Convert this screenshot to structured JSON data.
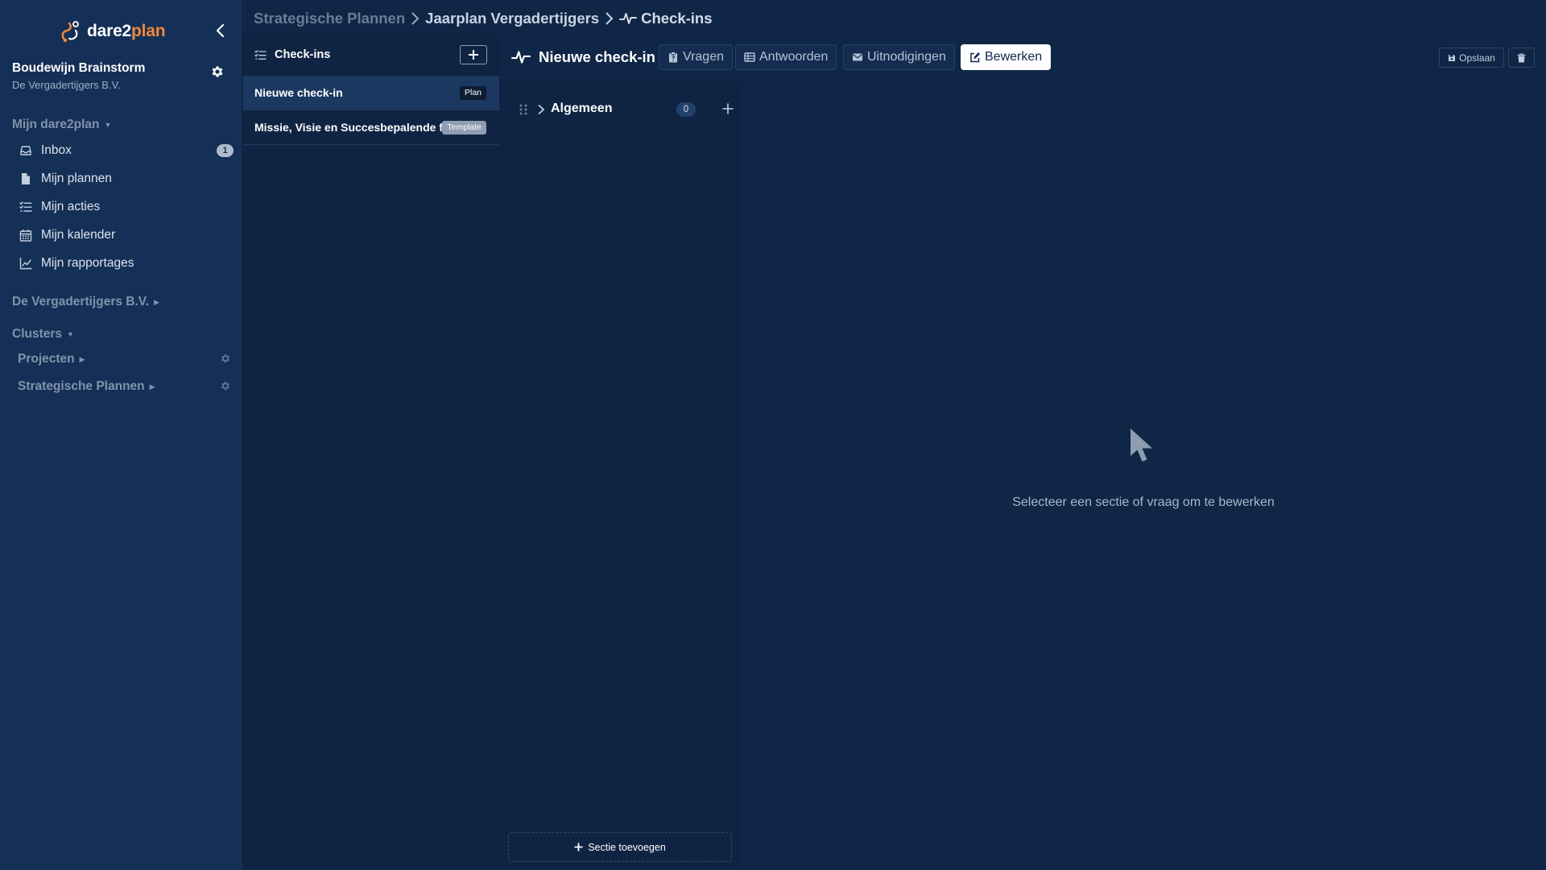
{
  "app": {
    "logo_part1": "dare2",
    "logo_part2": "plan",
    "brand_color": "#f0883a"
  },
  "user": {
    "name": "Boudewijn Brainstorm",
    "organization": "De Vergadertijgers B.V."
  },
  "sidebar": {
    "my_section_title": "Mijn dare2plan",
    "items": [
      {
        "label": "Inbox",
        "icon": "inbox-icon",
        "badge": "1"
      },
      {
        "label": "Mijn plannen",
        "icon": "file-icon"
      },
      {
        "label": "Mijn acties",
        "icon": "list-check-icon"
      },
      {
        "label": "Mijn kalender",
        "icon": "calendar-icon"
      },
      {
        "label": "Mijn rapportages",
        "icon": "chart-line-icon"
      }
    ],
    "org_section_title": "De Vergadertijgers B.V.",
    "clusters_title": "Clusters",
    "clusters": [
      {
        "label": "Projecten"
      },
      {
        "label": "Strategische Plannen"
      }
    ]
  },
  "breadcrumb": {
    "items": [
      "Strategische Plannen",
      "Jaarplan Vergadertijgers"
    ],
    "current": "Check-ins"
  },
  "list_panel": {
    "title": "Check-ins",
    "items": [
      {
        "title": "Nieuwe check-in",
        "tag": "Plan",
        "selected": true
      },
      {
        "title": "Missie, Visie en Succesbepalende f...",
        "tag": "Template",
        "selected": false
      }
    ]
  },
  "editor": {
    "title": "Nieuwe check-in",
    "tabs": [
      {
        "label": "Vragen",
        "icon": "clipboard-icon"
      },
      {
        "label": "Antwoorden",
        "icon": "table-icon"
      },
      {
        "label": "Uitnodigingen",
        "icon": "envelope-icon"
      },
      {
        "label": "Bewerken",
        "icon": "edit-icon",
        "active": true
      }
    ],
    "save_label": "Opslaan"
  },
  "sections": {
    "items": [
      {
        "label": "Algemeen",
        "count": "0"
      }
    ],
    "add_label": "Sectie toevoegen"
  },
  "empty_state": {
    "text": "Selecteer een sectie of vraag om te bewerken"
  }
}
